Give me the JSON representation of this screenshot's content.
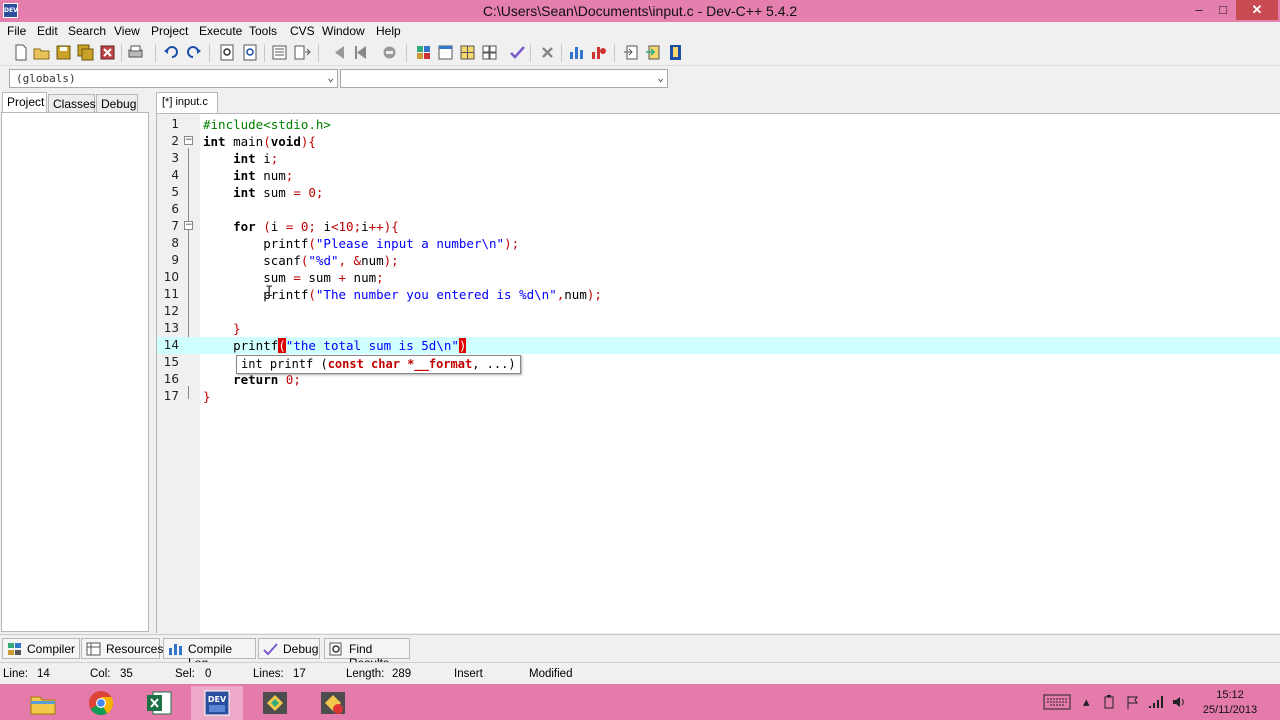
{
  "window": {
    "title": "C:\\Users\\Sean\\Documents\\input.c - Dev-C++ 5.4.2",
    "app_icon_text": "DEV",
    "min": "–",
    "max": "□",
    "close": "✕"
  },
  "menu": [
    "File",
    "Edit",
    "Search",
    "View",
    "Project",
    "Execute",
    "Tools",
    "CVS",
    "Window",
    "Help"
  ],
  "toolbar_icons": [
    "new-file-icon",
    "open-icon",
    "save-icon",
    "save-all-icon",
    "close-file-icon",
    "print-icon",
    "undo-icon",
    "redo-icon",
    "find-icon",
    "replace-icon",
    "indent-icon",
    "unindent-icon",
    "bookmark-prev-icon",
    "bookmark-next-icon",
    "toggle-bookmark-icon",
    "layout-icon",
    "window-icon",
    "grid-icon",
    "grid2-icon",
    "check-icon",
    "delete-icon",
    "chart-icon",
    "profile-icon",
    "goto-icon",
    "export-icon",
    "info-icon"
  ],
  "combos": {
    "scope": "(globals)",
    "members": ""
  },
  "left_tabs": [
    "Project",
    "Classes",
    "Debug"
  ],
  "editor_tab": "[*] input.c",
  "code": {
    "l1": "#include<stdio.h>",
    "l2a": "int",
    "l2b": " main",
    "l2c": "(",
    "l2d": "void",
    "l2e": "){",
    "l3a": "int",
    "l3b": " i",
    "l3c": ";",
    "l4a": "int",
    "l4b": " num",
    "l4c": ";",
    "l5a": "int",
    "l5b": " sum ",
    "l5c": "=",
    "l5d": " 0",
    "l5e": ";",
    "l7a": "for",
    "l7b": " (",
    "l7c": "i ",
    "l7d": "=",
    "l7e": " 0",
    "l7f": "; ",
    "l7g": "i",
    "l7h": "<",
    "l7i": "10",
    "l7j": ";",
    "l7k": "i",
    "l7l": "++){",
    "l8a": "printf",
    "l8b": "(",
    "l8c": "\"Please input a number\\n\"",
    "l8d": ");",
    "l9a": "scanf",
    "l9b": "(",
    "l9c": "\"%d\"",
    "l9d": ", &",
    "l9e": "num",
    "l9f": ");",
    "l10a": "sum ",
    "l10b": "=",
    "l10c": " sum ",
    "l10d": "+",
    "l10e": " num",
    "l10f": ";",
    "l11a": "printf",
    "l11b": "(",
    "l11c": "\"The number you entered is %d\\n\"",
    "l11d": ",",
    "l11e": "num",
    "l11f": ");",
    "l13": "}",
    "l14a": "printf",
    "l14b": "(",
    "l14c": "\"the total sum is 5d\\n\"",
    "l14d": ")",
    "l16a": "return",
    "l16b": " 0;",
    "l17": "}"
  },
  "line_numbers": [
    "1",
    "2",
    "3",
    "4",
    "5",
    "6",
    "7",
    "8",
    "9",
    "10",
    "11",
    "12",
    "13",
    "14",
    "15",
    "16",
    "17"
  ],
  "tooltip": {
    "prefix": "int printf (",
    "param": "const char *__format",
    "suffix": ", ...)"
  },
  "bottom_tabs": [
    "Compiler",
    "Resources",
    "Compile Log",
    "Debug",
    "Find Results"
  ],
  "status": {
    "line_label": "Line:",
    "line": "14",
    "col_label": "Col:",
    "col": "35",
    "sel_label": "Sel:",
    "sel": "0",
    "lines_label": "Lines:",
    "lines": "17",
    "length_label": "Length:",
    "length": "289",
    "mode": "Insert",
    "state": "Modified"
  },
  "taskbar": {
    "apps": [
      "file-explorer-icon",
      "chrome-icon",
      "excel-icon",
      "devcpp-icon",
      "app-green-icon",
      "app-red-icon"
    ],
    "time": "15:12",
    "date": "25/11/2013"
  },
  "colors": {
    "titlebar": "#e57fae",
    "taskbar": "#e47bab",
    "current_line": "#cfffff",
    "bracket_highlight": "#e00000"
  }
}
